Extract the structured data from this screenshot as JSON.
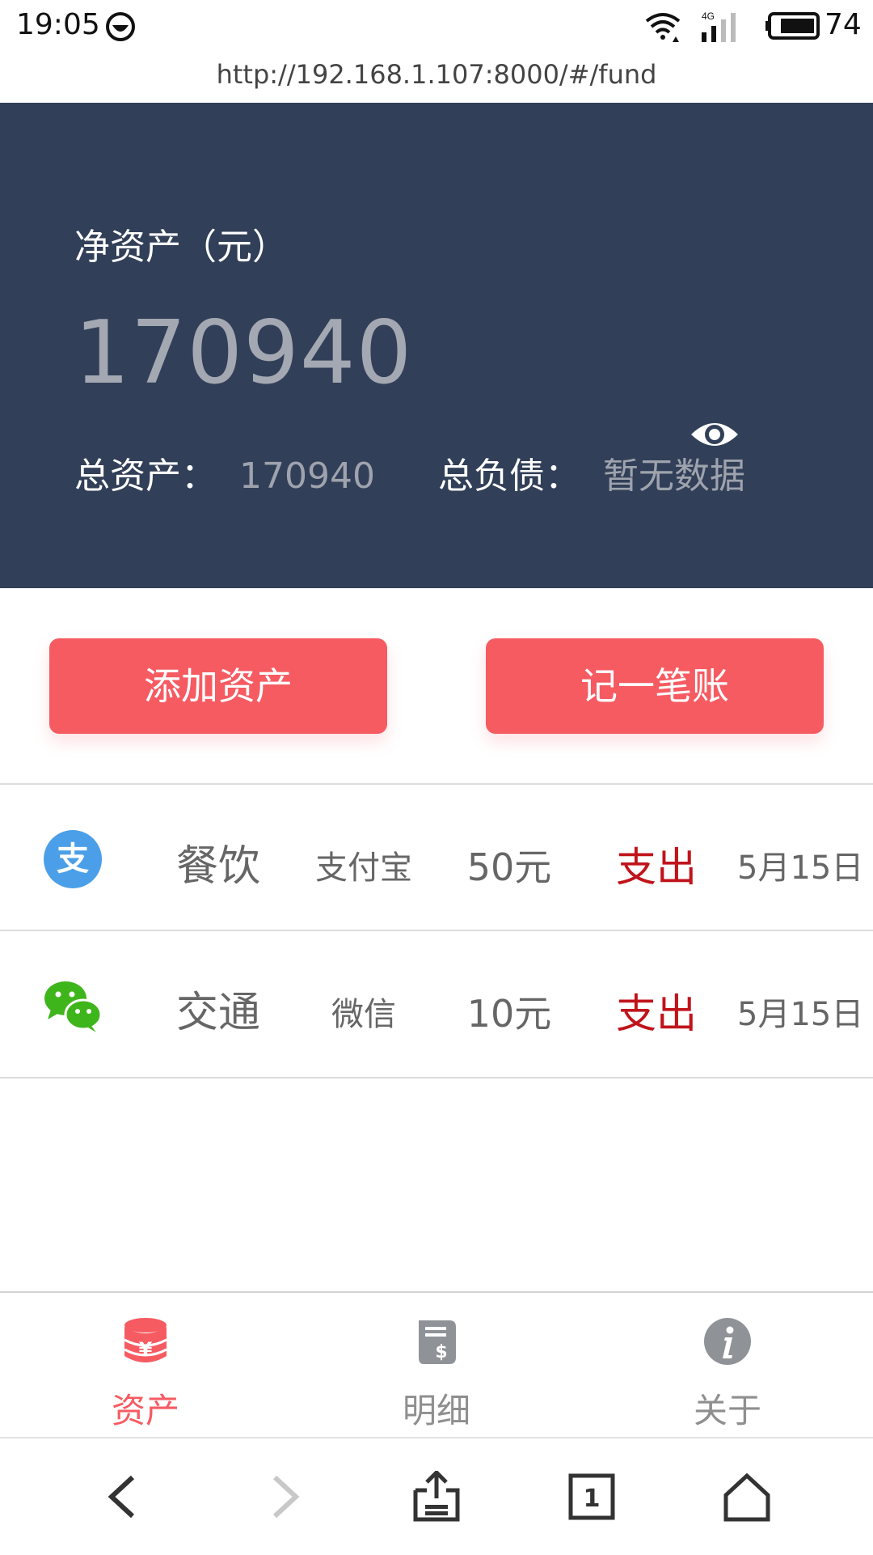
{
  "status_bar": {
    "time": "19:05",
    "network": "4G",
    "battery": "74",
    "icons": [
      "face-icon",
      "wifi-icon",
      "signal-icon",
      "battery-icon"
    ]
  },
  "browser": {
    "url": "http://192.168.1.107:8000/#/fund"
  },
  "summary": {
    "net_label": "净资产（元）",
    "net_value": "170940",
    "total_assets_label": "总资产：",
    "total_assets_value": "170940",
    "total_liabilities_label": "总负债：",
    "total_liabilities_value": "暂无数据"
  },
  "actions": {
    "add_asset": "添加资产",
    "record": "记一笔账"
  },
  "records": [
    {
      "icon": "alipay-icon",
      "category": "餐饮",
      "account": "支付宝",
      "amount": "50元",
      "type": "支出",
      "date": "5月15日"
    },
    {
      "icon": "wechat-icon",
      "category": "交通",
      "account": "微信",
      "amount": "10元",
      "type": "支出",
      "date": "5月15日"
    }
  ],
  "tabs": [
    {
      "label": "资产",
      "icon": "coins-icon",
      "active": true
    },
    {
      "label": "明细",
      "icon": "receipt-icon",
      "active": false
    },
    {
      "label": "关于",
      "icon": "info-icon",
      "active": false
    }
  ],
  "colors": {
    "header_bg": "#323f58",
    "accent": "#f65b62",
    "expense": "#c0141b",
    "alipay": "#4a9fe8",
    "wechat": "#3fb51c"
  }
}
